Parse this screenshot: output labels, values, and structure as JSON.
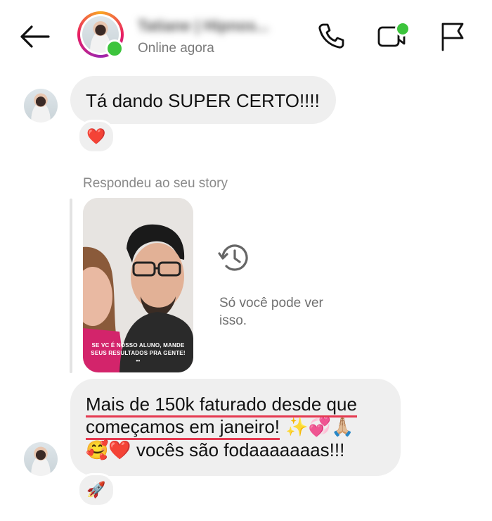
{
  "header": {
    "contact_name": "Tatiane | Hipnos...",
    "status": "Online agora",
    "icons": {
      "back": "arrow-left-icon",
      "call": "phone-icon",
      "video": "video-camera-icon",
      "report": "flag-icon"
    },
    "online_color": "#3cc43c"
  },
  "messages": [
    {
      "text": "Tá dando SUPER CERTO!!!!",
      "reaction": "❤️"
    },
    {
      "story_reply_label": "Respondeu ao seu story",
      "story_caption": "SE VC É NOSSO ALUNO, MANDE SEUS RESULTADOS PRA GENTE! ••",
      "story_notice": "Só você pode ver isso.",
      "story_notice_icon": "history-icon"
    },
    {
      "line1": "Mais de 150k faturado desde que",
      "line2": "começamos em janeiro!",
      "line2_emojis": " ✨💞🙏🏼",
      "line3_emojis": "🥰❤️",
      "line3_text": " vocês são fodaaaaaaas!!!",
      "reaction": "🚀",
      "underline_color": "#e53950"
    }
  ],
  "colors": {
    "bubble": "#efefef",
    "secondary_text": "#8a8a8a"
  }
}
